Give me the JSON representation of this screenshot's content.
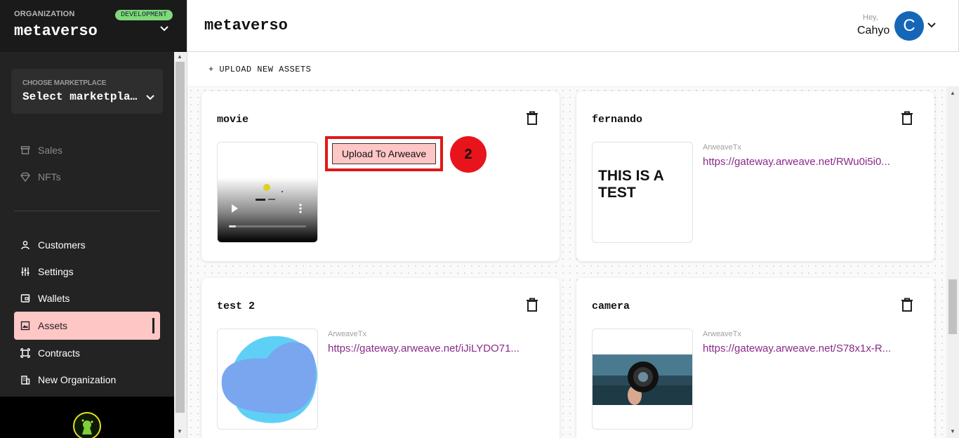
{
  "sidebar": {
    "org_label": "ORGANIZATION",
    "env_badge": "DEVELOPMENT",
    "org_name": "metaverso",
    "marketplace": {
      "label": "CHOOSE MARKETPLACE",
      "value": "Select marketplace"
    },
    "items": [
      {
        "label": "Sales",
        "icon": "store-icon",
        "enabled": false
      },
      {
        "label": "NFTs",
        "icon": "diamond-icon",
        "enabled": false
      },
      {
        "label": "Customers",
        "icon": "user-icon",
        "enabled": true
      },
      {
        "label": "Settings",
        "icon": "sliders-icon",
        "enabled": true
      },
      {
        "label": "Wallets",
        "icon": "wallet-icon",
        "enabled": true
      },
      {
        "label": "Assets",
        "icon": "image-icon",
        "enabled": true,
        "active": true
      },
      {
        "label": "Contracts",
        "icon": "contract-icon",
        "enabled": true
      },
      {
        "label": "New Organization",
        "icon": "building-icon",
        "enabled": true
      }
    ]
  },
  "header": {
    "title": "metaverso",
    "greeting": "Hey,",
    "username": "Cahyo",
    "avatar_initial": "C"
  },
  "upload_bar": {
    "label": "+ UPLOAD NEW ASSETS"
  },
  "assets": [
    {
      "name": "movie",
      "type": "video",
      "action_label": "Upload To Arweave",
      "step_marker": "2"
    },
    {
      "name": "fernando",
      "tx_label": "ArweaveTx",
      "tx_url": "https://gateway.arweave.net/RWu0i5i0...",
      "thumb_text": "THIS IS A TEST"
    },
    {
      "name": "test 2",
      "tx_label": "ArweaveTx",
      "tx_url": "https://gateway.arweave.net/iJiLYDO71..."
    },
    {
      "name": "camera",
      "tx_label": "ArweaveTx",
      "tx_url": "https://gateway.arweave.net/S78x1x-R..."
    }
  ],
  "colors": {
    "accent": "#ffc6c6",
    "highlight": "#e01818",
    "link": "#8a2a8a",
    "badge": "#7fd97a",
    "avatar": "#1666b8"
  }
}
